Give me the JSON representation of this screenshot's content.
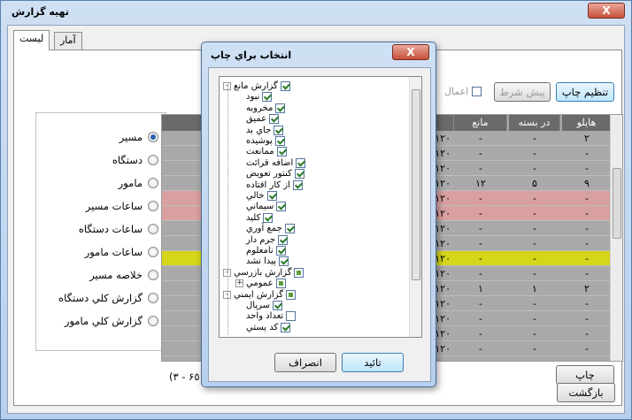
{
  "window": {
    "title": "تهيه گزارش",
    "close_glyph": "X"
  },
  "tabs": [
    {
      "label": "آمار"
    },
    {
      "label": "ليست"
    }
  ],
  "toolbar": {
    "settings_label": "تنظيم چاپ",
    "preview_label": "پيش شرط",
    "apply_label": "اعمال"
  },
  "radios": [
    {
      "label": "مسير",
      "selected": true
    },
    {
      "label": "دستگاه",
      "selected": false
    },
    {
      "label": "مامور",
      "selected": false
    },
    {
      "label": "ساعات مسير",
      "selected": false
    },
    {
      "label": "ساعات دستگاه",
      "selected": false
    },
    {
      "label": "ساعات مامور",
      "selected": false
    },
    {
      "label": "خلاصه مسير",
      "selected": false
    },
    {
      "label": "گزارش کلي دستگاه",
      "selected": false
    },
    {
      "label": "گزارش کلي مامور",
      "selected": false
    }
  ],
  "grid": {
    "headers": [
      "هايلو",
      "در بسته",
      "مانع",
      "ر"
    ],
    "rows": [
      {
        "c": [
          "٢",
          "-",
          "-",
          "١٢٠"
        ],
        "bg": "#a9a9a9"
      },
      {
        "c": [
          "-",
          "-",
          "-",
          "١٢٠"
        ],
        "bg": "#a9a9a9"
      },
      {
        "c": [
          "-",
          "-",
          "-",
          "١٢٠"
        ],
        "bg": "#a9a9a9"
      },
      {
        "c": [
          "٩",
          "۵",
          "١٢",
          "١٢٠"
        ],
        "bg": "#a9a9a9"
      },
      {
        "c": [
          "-",
          "-",
          "-",
          "١٢٠"
        ],
        "bg": "#d9a0a0"
      },
      {
        "c": [
          "-",
          "-",
          "-",
          "١٢٠"
        ],
        "bg": "#d9a0a0"
      },
      {
        "c": [
          "-",
          "-",
          "-",
          "١٢٠"
        ],
        "bg": "#a9a9a9"
      },
      {
        "c": [
          "-",
          "-",
          "-",
          "١٢٠"
        ],
        "bg": "#a9a9a9"
      },
      {
        "c": [
          "-",
          "-",
          "-",
          "١٢٠"
        ],
        "bg": "#d5d51a"
      },
      {
        "c": [
          "-",
          "-",
          "-",
          "١٢٠"
        ],
        "bg": "#a9a9a9"
      },
      {
        "c": [
          "٢",
          "١",
          "١",
          "١٢٠"
        ],
        "bg": "#a9a9a9"
      },
      {
        "c": [
          "-",
          "-",
          "-",
          "١٢٠"
        ],
        "bg": "#a9a9a9"
      },
      {
        "c": [
          "-",
          "-",
          "-",
          "١٢٠"
        ],
        "bg": "#a9a9a9"
      },
      {
        "c": [
          "-",
          "-",
          "-",
          "١٢٠"
        ],
        "bg": "#a9a9a9"
      },
      {
        "c": [
          "-",
          "-",
          "-",
          "١٢٠"
        ],
        "bg": "#a9a9a9"
      }
    ]
  },
  "range_text": "(٣ - ۶٥٠)",
  "print_label": "چاپ",
  "back_label": "بازگشت",
  "dialog": {
    "title": "انتخاب براي چاپ",
    "close_glyph": "X",
    "ok_label": "تائيد",
    "cancel_label": "انصراف",
    "tree": [
      {
        "label": "گزارش مانع",
        "level": 0,
        "state": "on",
        "expander": "-"
      },
      {
        "label": "نبود",
        "level": 1,
        "state": "on"
      },
      {
        "label": "مخروبه",
        "level": 1,
        "state": "on"
      },
      {
        "label": "عميق",
        "level": 1,
        "state": "on"
      },
      {
        "label": "جاي بد",
        "level": 1,
        "state": "on"
      },
      {
        "label": "پوشيده",
        "level": 1,
        "state": "on"
      },
      {
        "label": "ممانعت",
        "level": 1,
        "state": "on"
      },
      {
        "label": "اضافه قرائت",
        "level": 1,
        "state": "on"
      },
      {
        "label": "کنتور تعويض",
        "level": 1,
        "state": "on"
      },
      {
        "label": "از کار افتاده",
        "level": 1,
        "state": "on"
      },
      {
        "label": "خالي",
        "level": 1,
        "state": "on"
      },
      {
        "label": "سيماني",
        "level": 1,
        "state": "on"
      },
      {
        "label": "کليد",
        "level": 1,
        "state": "on"
      },
      {
        "label": "جمع آوري",
        "level": 1,
        "state": "on"
      },
      {
        "label": "جرم دار",
        "level": 1,
        "state": "on"
      },
      {
        "label": "نامعلوم",
        "level": 1,
        "state": "on"
      },
      {
        "label": "پيدا نشد",
        "level": 1,
        "state": "on"
      },
      {
        "label": "گزارش بازرسي",
        "level": 0,
        "state": "part",
        "expander": "-"
      },
      {
        "label": "عمومي",
        "level": 1,
        "state": "part",
        "expander": "+"
      },
      {
        "label": "گزارش ايمني",
        "level": 0,
        "state": "part",
        "expander": "-"
      },
      {
        "label": "سرپال",
        "level": 1,
        "state": "on"
      },
      {
        "label": "تعداد واحد",
        "level": 1,
        "state": "off"
      },
      {
        "label": "کد پستي",
        "level": 1,
        "state": "on"
      }
    ]
  }
}
